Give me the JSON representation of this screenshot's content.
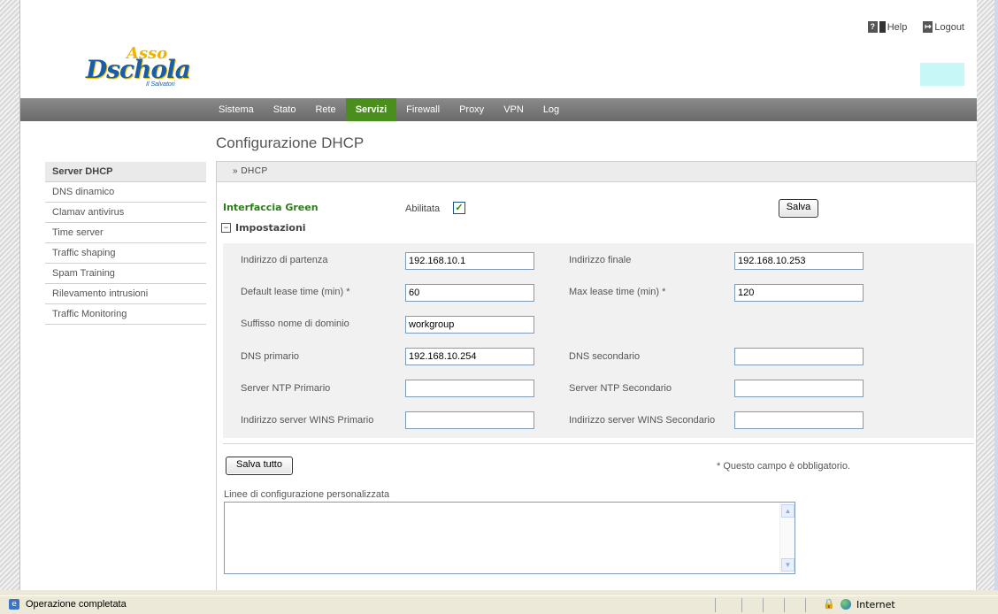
{
  "top_links": {
    "help": "Help",
    "logout": "Logout"
  },
  "logo": {
    "top": "Asso",
    "main": "Dschola",
    "sub": "Il Salvatori"
  },
  "nav": [
    "Sistema",
    "Stato",
    "Rete",
    "Servizi",
    "Firewall",
    "Proxy",
    "VPN",
    "Log"
  ],
  "nav_active": "Servizi",
  "page_title": "Configurazione DHCP",
  "sidebar": [
    "Server DHCP",
    "DNS dinamico",
    "Clamav antivirus",
    "Time server",
    "Traffic shaping",
    "Spam Training",
    "Rilevamento intrusioni",
    "Traffic Monitoring"
  ],
  "panel": {
    "header": "»  DHCP",
    "interface_label": "Interfaccia Green",
    "enabled_label": "Abilitata",
    "enabled": true,
    "save_label": "Salva",
    "section_label": "Impostazioni",
    "fields": {
      "start_label": "Indirizzo di partenza",
      "start_value": "192.168.10.1",
      "end_label": "Indirizzo finale",
      "end_value": "192.168.10.253",
      "default_lease_label": "Default lease time (min) *",
      "default_lease_value": "60",
      "max_lease_label": "Max lease time (min) *",
      "max_lease_value": "120",
      "domain_label": "Suffisso nome di dominio",
      "domain_value": "workgroup",
      "dns1_label": "DNS primario",
      "dns1_value": "192.168.10.254",
      "dns2_label": "DNS secondario",
      "dns2_value": "",
      "ntp1_label": "Server NTP Primario",
      "ntp1_value": "",
      "ntp2_label": "Server NTP Secondario",
      "ntp2_value": "",
      "wins1_label": "Indirizzo server WINS Primario",
      "wins1_value": "",
      "wins2_label": "Indirizzo server WINS Secondario",
      "wins2_value": ""
    },
    "save_all_label": "Salva tutto",
    "required_note": "* Questo campo è obbligatorio.",
    "custom_lines_label": "Linee di configurazione personalizzata"
  },
  "status": {
    "text": "Operazione completata",
    "zone": "Internet"
  }
}
